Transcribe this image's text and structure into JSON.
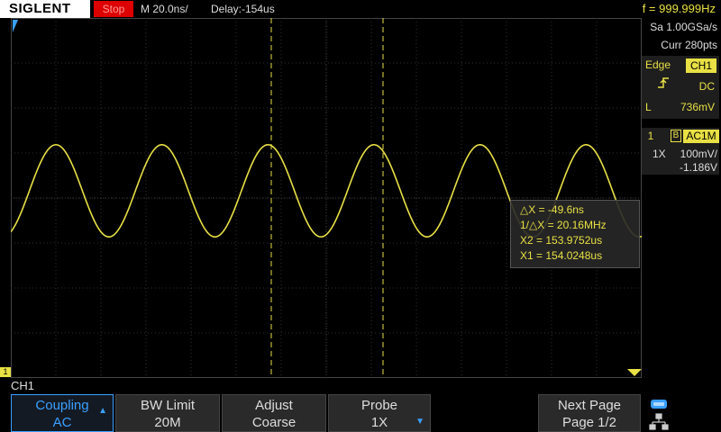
{
  "header": {
    "brand": "SIGLENT",
    "run_status": "Stop",
    "timebase": "M 20.0ns/",
    "delay": "Delay:-154us",
    "frequency": "f = 999.999Hz"
  },
  "acquisition": {
    "sample_rate": "Sa 1.00GSa/s",
    "curr_points": "Curr 280pts"
  },
  "trigger": {
    "label": "Edge",
    "source": "CH1",
    "slope_icon": "rising-edge-icon",
    "coupling": "DC",
    "level_label": "L",
    "level": "736mV"
  },
  "channel": {
    "number": "1",
    "bw_marker": "B",
    "coupling": "AC1M",
    "probe": "1X",
    "scale": "100mV/",
    "offset": "-1.186V"
  },
  "cursor": {
    "delta_x": "△X = -49.6ns",
    "inv_delta_x": "1/△X = 20.16MHz",
    "x2": "X2 = 153.9752us",
    "x1": "X1 = 154.0248us"
  },
  "menu": {
    "title": "CH1",
    "softkeys": [
      {
        "label": "Coupling",
        "value": "AC"
      },
      {
        "label": "BW Limit",
        "value": "20M"
      },
      {
        "label": "Adjust",
        "value": "Coarse"
      },
      {
        "label": "Probe",
        "value": "1X"
      },
      {
        "label": "Next Page",
        "value": "Page 1/2"
      }
    ]
  },
  "markers": {
    "channel_marker": "1"
  },
  "colors": {
    "trace": "#e8e044",
    "accent": "#3aa0ff",
    "stop": "#dd0000"
  },
  "waveform": {
    "cycles_visible": 5.95,
    "peak_level": 0.62,
    "amplitude": 0.16
  }
}
